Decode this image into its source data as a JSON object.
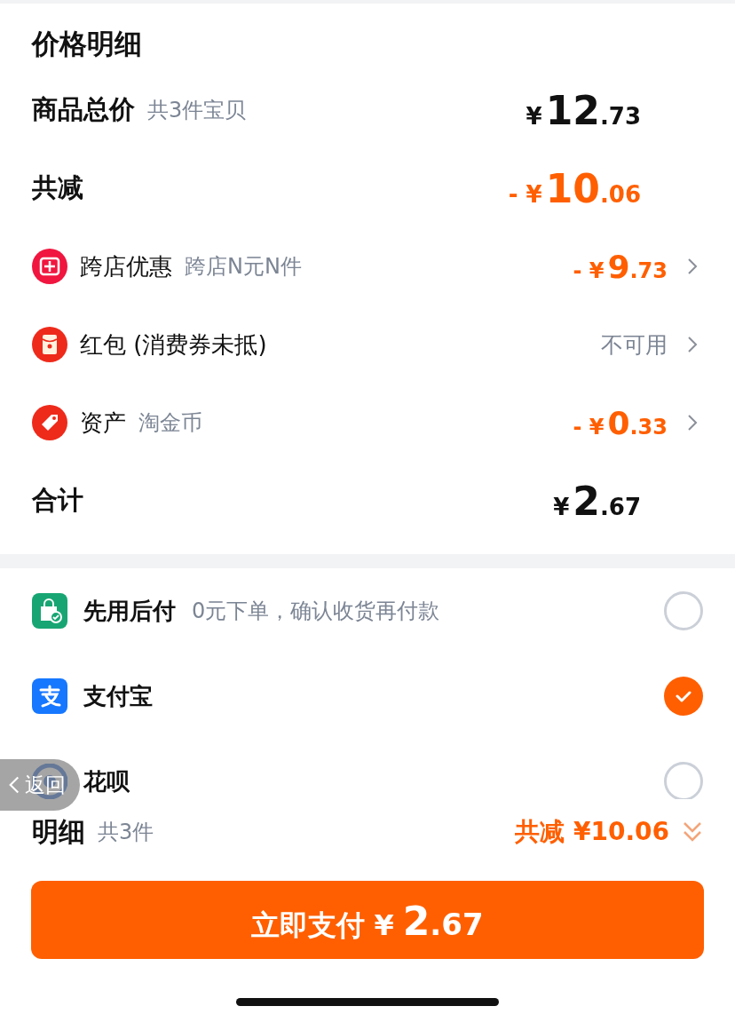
{
  "title": "价格明细",
  "summary": [
    {
      "label": "商品总价",
      "note": "共3件宝贝",
      "prefix": "¥",
      "integer": "12",
      "decimal": ".73",
      "accent": false
    },
    {
      "label": "共减",
      "prefix": "- ¥",
      "integer": "10",
      "decimal": ".06",
      "accent": true
    }
  ],
  "discounts": [
    {
      "kind": "cross_store",
      "label": "跨店优惠",
      "note": "跨店N元N件",
      "prefix": "- ¥",
      "integer": "9",
      "decimal": ".73"
    },
    {
      "kind": "red_packet",
      "label": "红包 (消费券未抵)",
      "status": "不可用"
    },
    {
      "kind": "asset",
      "label": "资产",
      "note": "淘金币",
      "prefix": "- ¥",
      "integer": "0",
      "decimal": ".33"
    }
  ],
  "grand_total": {
    "label": "合计",
    "prefix": "¥",
    "integer": "2",
    "decimal": ".67"
  },
  "payment_methods": [
    {
      "kind": "paylater",
      "name": "先用后付",
      "note": "0元下单，确认收货再付款",
      "selected": false
    },
    {
      "kind": "alipay",
      "name": "支付宝",
      "selected": true
    },
    {
      "kind": "huabei",
      "name": "花呗",
      "selected": false
    }
  ],
  "back_button": {
    "label": "返回"
  },
  "footer": {
    "label": "明细",
    "count": "共3件",
    "discount": "共减 ¥10.06"
  },
  "pay_button": {
    "label": "立即支付",
    "prefix": "¥",
    "integer": "2",
    "decimal": ".67"
  }
}
